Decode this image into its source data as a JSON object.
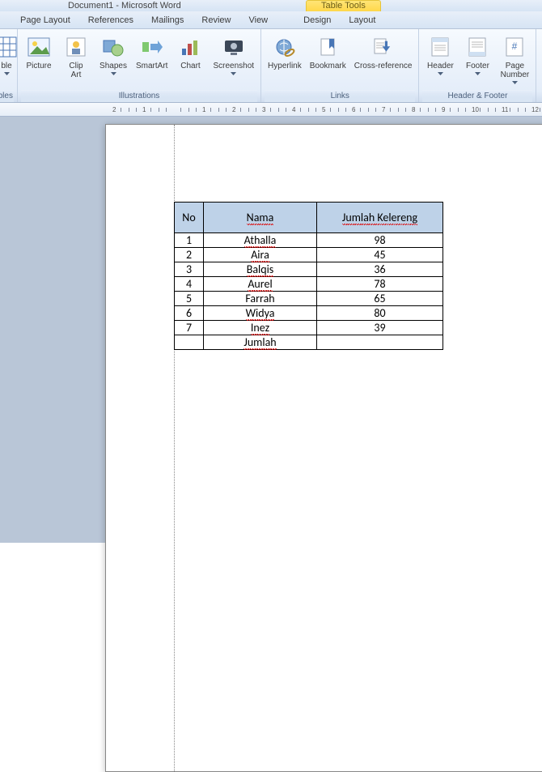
{
  "window": {
    "title": "Document1 - Microsoft Word"
  },
  "context_tab": "Table Tools",
  "tabs": {
    "page_layout": "Page Layout",
    "references": "References",
    "mailings": "Mailings",
    "review": "Review",
    "view": "View",
    "design": "Design",
    "layout": "Layout"
  },
  "ribbon": {
    "table_fragment": {
      "label": "Tables",
      "item": "ble"
    },
    "illustrations": {
      "label": "Illustrations",
      "picture": "Picture",
      "clip_art": "Clip\nArt",
      "shapes": "Shapes",
      "smartart": "SmartArt",
      "chart": "Chart",
      "screenshot": "Screenshot"
    },
    "links": {
      "label": "Links",
      "hyperlink": "Hyperlink",
      "bookmark": "Bookmark",
      "cross_reference": "Cross-reference"
    },
    "header_footer": {
      "label": "Header & Footer",
      "header": "Header",
      "footer": "Footer",
      "page_number": "Page\nNumber"
    }
  },
  "ruler_marks": [
    "1",
    "2",
    "1",
    "1",
    "2",
    "3",
    "4",
    "5",
    "6",
    "7",
    "8",
    "9",
    "10",
    "11",
    "12"
  ],
  "table": {
    "headers": {
      "no": "No",
      "nama": "Nama",
      "jumlah": "Jumlah Kelereng"
    },
    "rows": [
      {
        "no": "1",
        "nama": "Athalla",
        "jumlah": "98"
      },
      {
        "no": "2",
        "nama": "Aira",
        "jumlah": "45"
      },
      {
        "no": "3",
        "nama": "Balqis",
        "jumlah": "36"
      },
      {
        "no": "4",
        "nama": "Aurel",
        "jumlah": "78"
      },
      {
        "no": "5",
        "nama": "Farrah",
        "jumlah": "65"
      },
      {
        "no": "6",
        "nama": "Widya",
        "jumlah": "80"
      },
      {
        "no": "7",
        "nama": "Inez",
        "jumlah": "39"
      }
    ],
    "footer": {
      "no": "",
      "nama": "Jumlah",
      "jumlah": ""
    }
  }
}
